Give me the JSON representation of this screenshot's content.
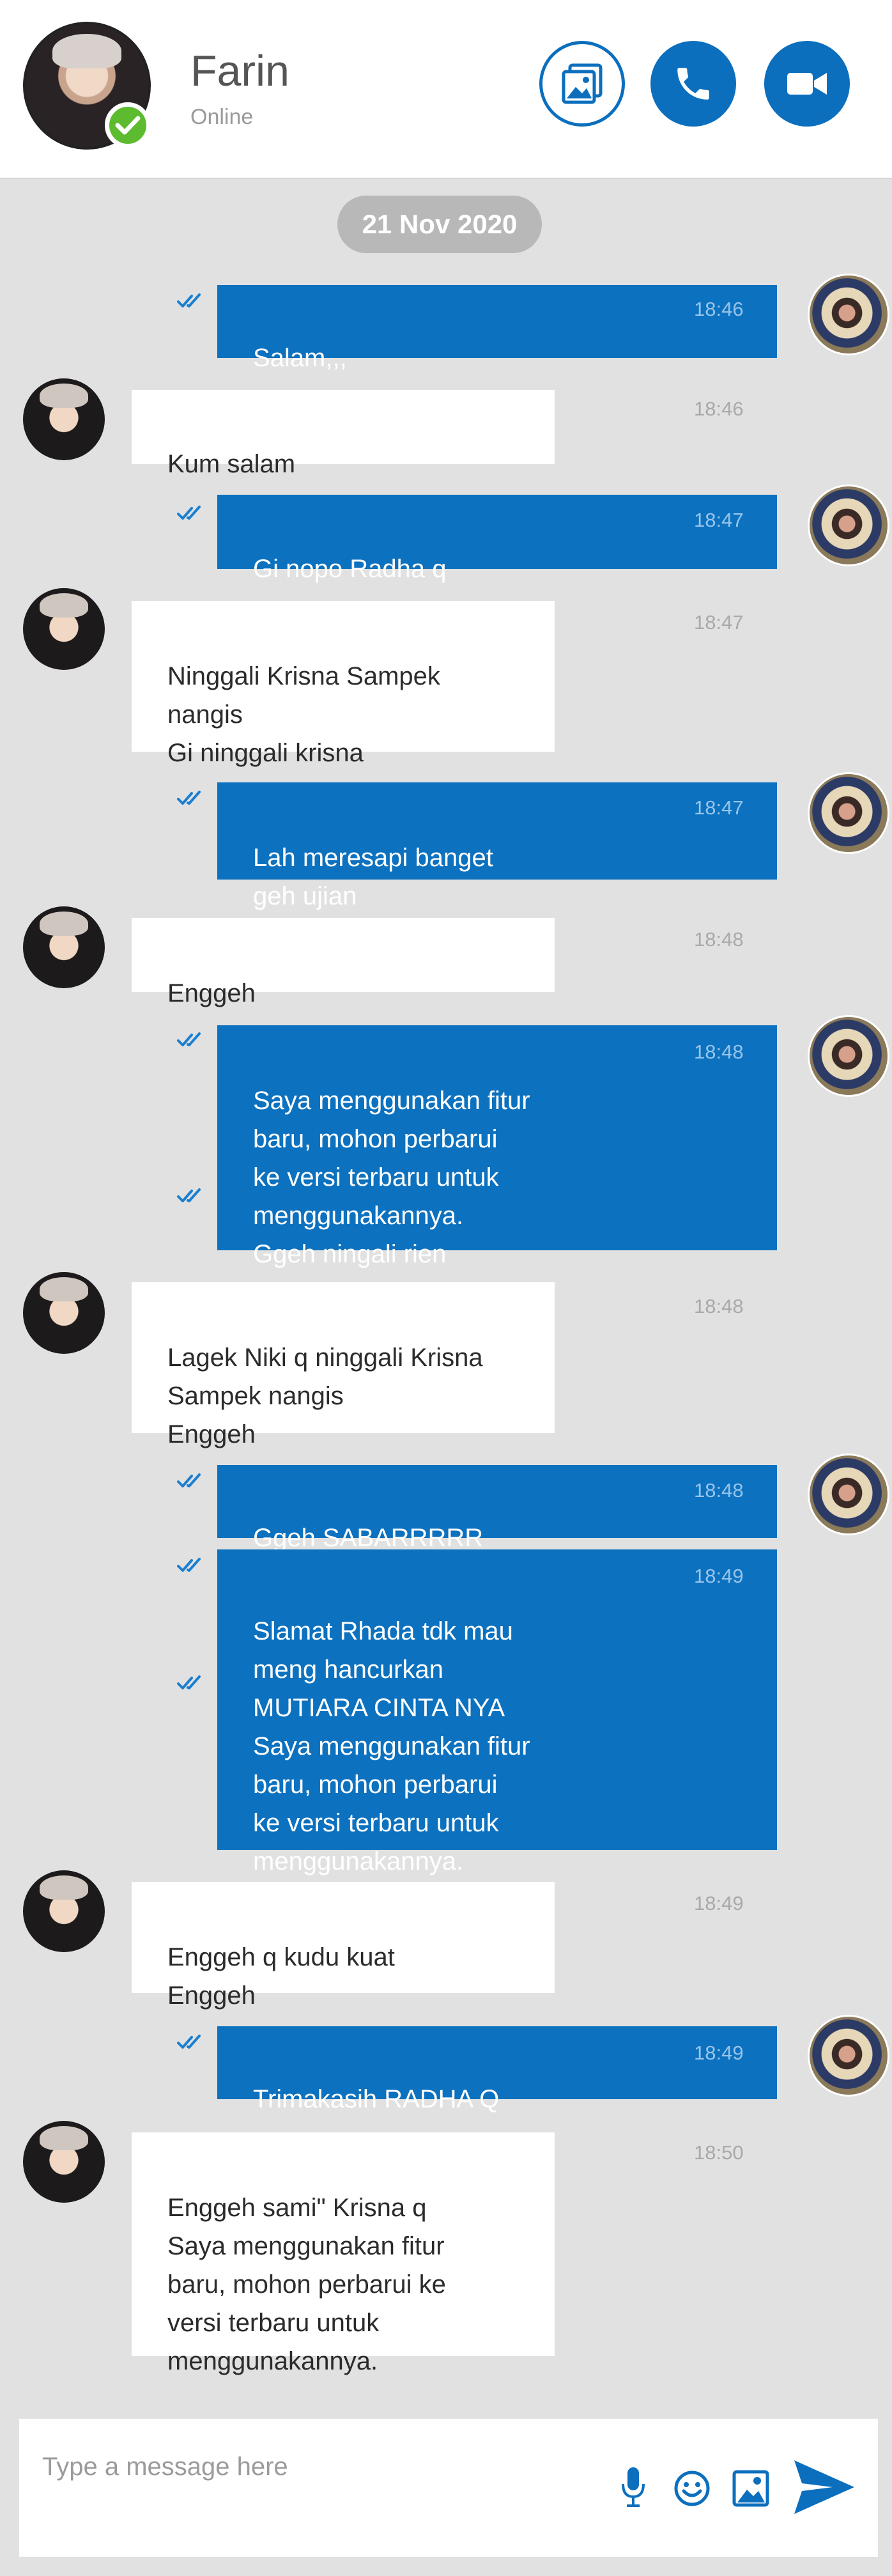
{
  "header": {
    "contact_name": "Farin",
    "contact_status": "Online"
  },
  "date_chip": "21 Nov 2020",
  "messages": [
    {
      "dir": "out",
      "text": "Salam,,,",
      "time": "18:46"
    },
    {
      "dir": "in",
      "text": "Kum salam",
      "time": "18:46"
    },
    {
      "dir": "out",
      "text": "Gi nopo Radha q",
      "time": "18:47"
    },
    {
      "dir": "in",
      "text": "Ninggali Krisna Sampek\nnangis\nGi ninggali krisna",
      "time": "18:47"
    },
    {
      "dir": "out",
      "text": "Lah meresapi banget\ngeh  ujian",
      "time": "18:47"
    },
    {
      "dir": "in",
      "text": "Enggeh",
      "time": "18:48"
    },
    {
      "dir": "out",
      "text": "Saya menggunakan fitur\nbaru, mohon perbarui\nke versi terbaru untuk\nmenggunakannya.\nGgeh ningali rien",
      "time": "18:48"
    },
    {
      "dir": "in",
      "text": "Lagek Niki q ninggali Krisna\nSampek nangis\nEnggeh",
      "time": "18:48"
    },
    {
      "dir": "out",
      "text": "Ggeh SABARRRRR",
      "time": "18:48"
    },
    {
      "dir": "out",
      "text": "Slamat Rhada tdk mau\nmeng hancurkan\nMUTIARA CINTA NYA\nSaya menggunakan fitur\nbaru, mohon perbarui\nke versi terbaru untuk\nmenggunakannya.",
      "time": "18:49"
    },
    {
      "dir": "in",
      "text": "Enggeh q kudu kuat\nEnggeh",
      "time": "18:49"
    },
    {
      "dir": "out",
      "text": "Trimakasih RADHA Q",
      "time": "18:49"
    },
    {
      "dir": "in",
      "text": "Enggeh sami\" Krisna q\nSaya menggunakan fitur\nbaru, mohon perbarui ke\nversi terbaru untuk\nmenggunakannya.",
      "time": "18:50"
    }
  ],
  "composer": {
    "placeholder": "Type a message here"
  },
  "colors": {
    "accent": "#0c71bf",
    "online": "#5dbb2f",
    "background": "#e1e1e1"
  },
  "icons": [
    "gallery-icon",
    "phone-icon",
    "video-icon",
    "check-icon",
    "double-check-icon",
    "microphone-icon",
    "emoji-icon",
    "image-icon",
    "send-icon"
  ]
}
